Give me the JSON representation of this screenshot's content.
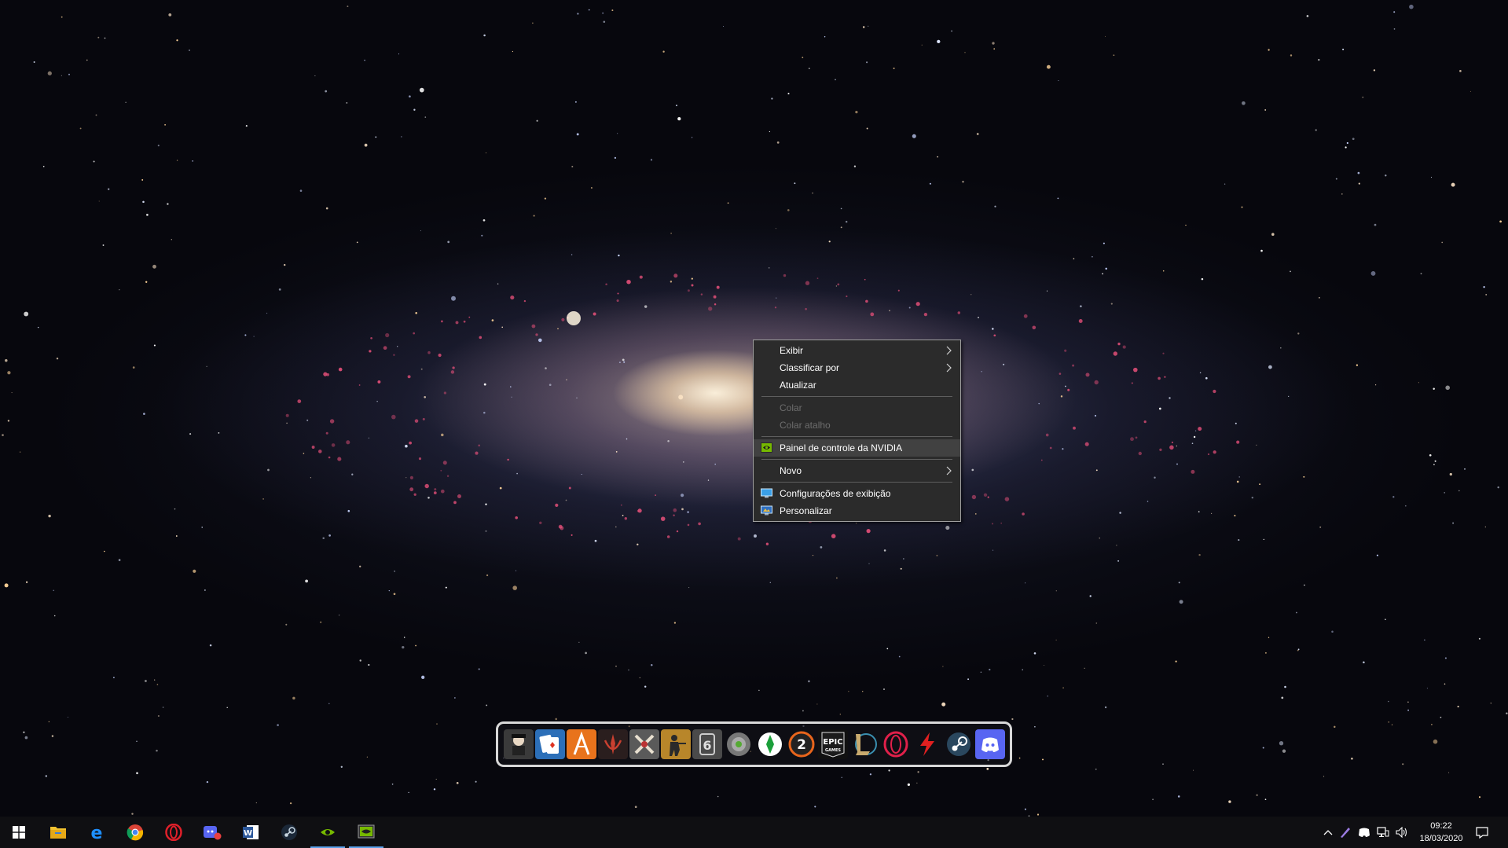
{
  "wallpaper": "andromeda-galaxy",
  "context_menu": {
    "items": [
      {
        "label": "Exibir",
        "submenu": true
      },
      {
        "label": "Classificar por",
        "submenu": true
      },
      {
        "label": "Atualizar"
      },
      {
        "label": "Colar",
        "disabled": true
      },
      {
        "label": "Colar atalho",
        "disabled": true
      },
      {
        "label": "Painel de controle da NVIDIA",
        "icon": "nvidia-icon"
      },
      {
        "label": "Novo",
        "submenu": true
      },
      {
        "label": "Configurações de exibição",
        "icon": "display-settings-icon"
      },
      {
        "label": "Personalizar",
        "icon": "personalize-icon"
      }
    ]
  },
  "dock": {
    "icons": [
      {
        "name": "game-character-icon",
        "color": "#3a3a3a"
      },
      {
        "name": "solitaire-cards-icon",
        "color": "#2c6fb8"
      },
      {
        "name": "fallout-shelter-icon",
        "color": "#e8731c"
      },
      {
        "name": "star-wars-jedi-icon",
        "color": "#2a1e1e"
      },
      {
        "name": "age-of-empires-icon",
        "color": "#5a5a5a"
      },
      {
        "name": "counter-strike-icon",
        "color": "#b8862a"
      },
      {
        "name": "rainbow-six-icon",
        "color": "#4a4a4a"
      },
      {
        "name": "round-game-icon",
        "color": "#6b6b6b"
      },
      {
        "name": "the-sims-icon",
        "color": "#1b9f3a"
      },
      {
        "name": "overwatch-2-icon",
        "color": "#e8651c",
        "text": "2"
      },
      {
        "name": "epic-games-icon",
        "color": "#111111",
        "text": "EPIC"
      },
      {
        "name": "league-of-legends-icon",
        "color": "#c8aa6e"
      },
      {
        "name": "opera-gx-icon",
        "color": "#1a0a12"
      },
      {
        "name": "lightning-app-icon",
        "color": "#111111"
      },
      {
        "name": "steam-icon",
        "color": "#1b2838"
      },
      {
        "name": "discord-icon",
        "color": "#5865f2"
      }
    ]
  },
  "taskbar": {
    "apps": [
      {
        "name": "file-explorer-icon",
        "color": "#f2c230"
      },
      {
        "name": "edge-legacy-icon",
        "color": "#1e90ff"
      },
      {
        "name": "chrome-icon",
        "color": "#2fa84f"
      },
      {
        "name": "opera-icon",
        "color": "#e0202a"
      },
      {
        "name": "discord-taskbar-icon",
        "color": "#5865f2"
      },
      {
        "name": "word-icon",
        "color": "#2b579a"
      },
      {
        "name": "steam-taskbar-icon",
        "color": "#c7d5e0"
      },
      {
        "name": "nvidia-taskbar-icon",
        "color": "#76b900"
      },
      {
        "name": "nvidia-control-panel-taskbar-icon",
        "color": "#76b900"
      }
    ],
    "clock": {
      "time": "09:22",
      "date": "18/03/2020"
    }
  }
}
